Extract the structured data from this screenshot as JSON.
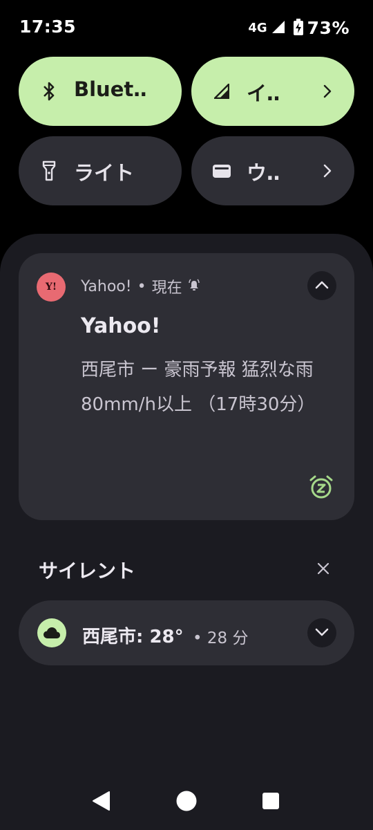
{
  "status_bar": {
    "time": "17:35",
    "network": "4G",
    "battery": "73%",
    "icons": [
      "signal-icon",
      "battery-charging-icon"
    ]
  },
  "quick_settings": {
    "tiles": [
      {
        "label": "Bluet‥",
        "icon": "bluetooth-icon",
        "state": "on"
      },
      {
        "label": "イ‥",
        "icon": "mobile-data-icon",
        "state": "on",
        "has_chevron": true
      },
      {
        "label": "ライト",
        "icon": "flashlight-icon",
        "state": "off"
      },
      {
        "label": "ウ‥",
        "icon": "wallet-icon",
        "state": "off",
        "has_chevron": true
      }
    ],
    "accent_on": "#c6eeab",
    "tile_off": "#2e2e35"
  },
  "notification": {
    "app_name": "Yahoo!",
    "separator": "•",
    "time": "現在",
    "app_icon_text": "Y!",
    "app_icon_color": "#e86a72",
    "title": "Yahoo!",
    "body": "西尾市 ー 豪雨予報 猛烈な雨 80mm/h以上 （17時30分）"
  },
  "silent_section": {
    "title": "サイレント",
    "item": {
      "title": "西尾市: 28°",
      "separator": "•",
      "time": "28 分",
      "icon": "cloud-icon"
    }
  },
  "nav_bar": {
    "buttons": [
      "back-button",
      "home-button",
      "recents-button"
    ]
  }
}
